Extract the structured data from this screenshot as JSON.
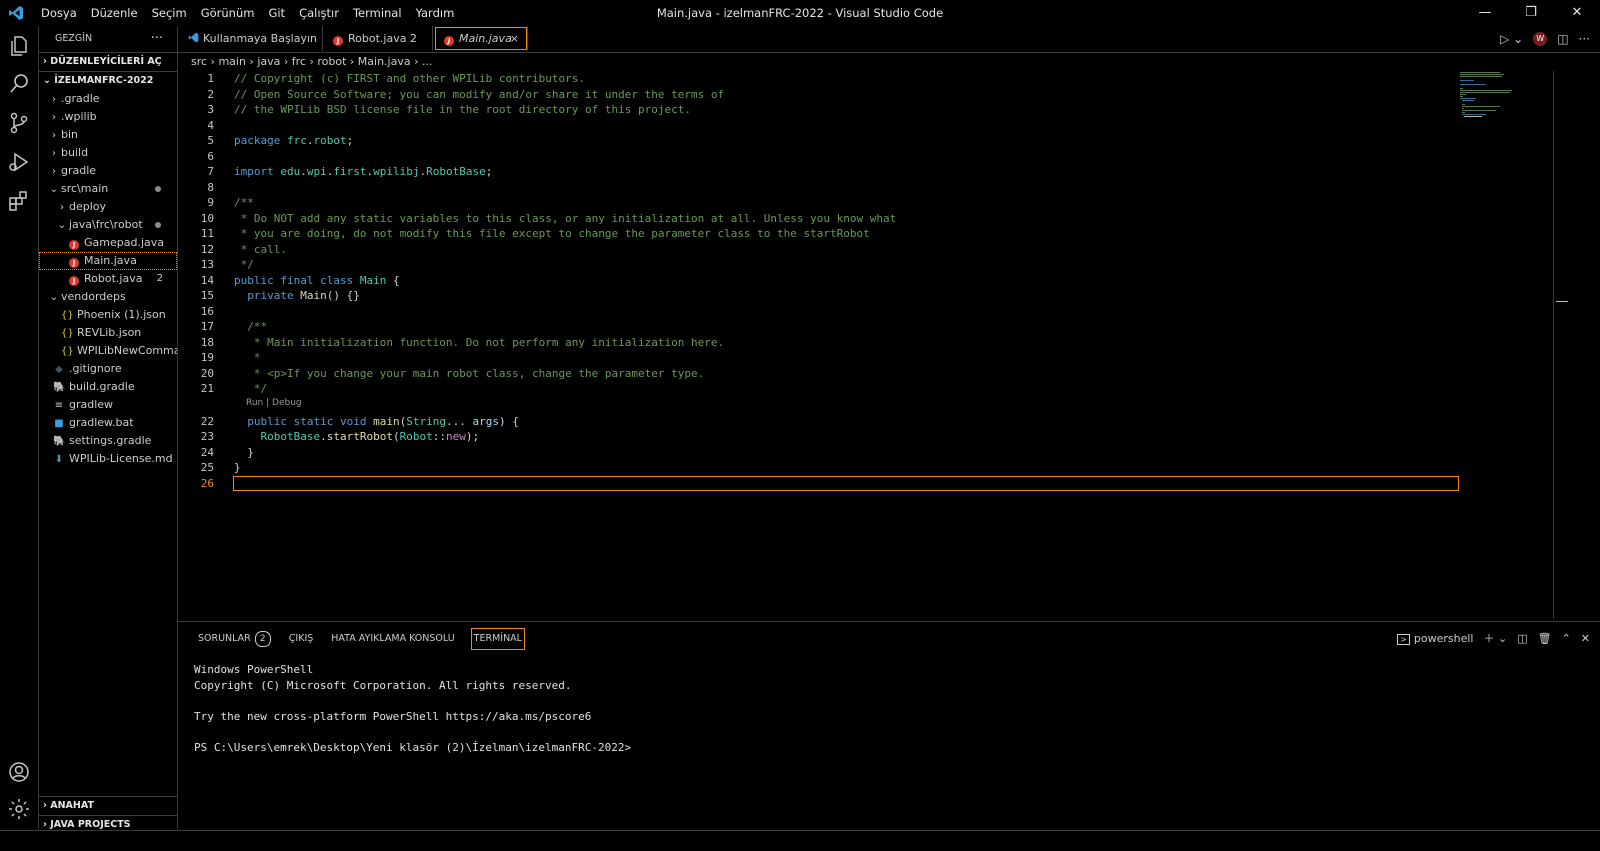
{
  "window": {
    "title": "Main.java - izelmanFRC-2022 - Visual Studio Code",
    "menu": [
      "Dosya",
      "Düzenle",
      "Seçim",
      "Görünüm",
      "Git",
      "Çalıştır",
      "Terminal",
      "Yardım"
    ],
    "controls": [
      "minimize-icon",
      "restore-icon",
      "close-icon"
    ]
  },
  "activity_bar": {
    "top": [
      "explorer-icon",
      "search-icon",
      "source-control-icon",
      "run-debug-icon",
      "extensions-icon"
    ],
    "bottom": [
      "account-icon",
      "settings-gear-icon"
    ]
  },
  "sidebar": {
    "title": "GEZGİN",
    "more": "···",
    "open_editors": "DÜZENLEYİCİLERİ AÇ",
    "project": "İZELMANFRC-2022",
    "tree": [
      {
        "label": ".gradle",
        "type": "folder",
        "chev": "›"
      },
      {
        "label": ".wpilib",
        "type": "folder",
        "chev": "›"
      },
      {
        "label": "bin",
        "type": "folder",
        "chev": "›"
      },
      {
        "label": "build",
        "type": "folder",
        "chev": "›"
      },
      {
        "label": "gradle",
        "type": "folder",
        "chev": "›"
      },
      {
        "label": "src\\main",
        "type": "folder",
        "chev": "⌄"
      },
      {
        "label": "deploy",
        "type": "folder",
        "chev": "›"
      },
      {
        "label": "java\\frc\\robot",
        "type": "folder",
        "chev": "⌄"
      },
      {
        "label": "Gamepad.java",
        "type": "java"
      },
      {
        "label": "Main.java",
        "type": "java"
      },
      {
        "label": "Robot.java",
        "type": "java",
        "badge": "2"
      },
      {
        "label": "vendordeps",
        "type": "folder",
        "chev": "⌄"
      },
      {
        "label": "Phoenix (1).json",
        "type": "json"
      },
      {
        "label": "REVLib.json",
        "type": "json"
      },
      {
        "label": "WPILibNewComma...",
        "type": "json"
      },
      {
        "label": ".gitignore",
        "type": "git"
      },
      {
        "label": "build.gradle",
        "type": "gradle"
      },
      {
        "label": "gradlew",
        "type": "text"
      },
      {
        "label": "gradlew.bat",
        "type": "bat"
      },
      {
        "label": "settings.gradle",
        "type": "gradle"
      },
      {
        "label": "WPILib-License.md",
        "type": "md"
      }
    ],
    "outline": "ANAHAT",
    "java_projects": "JAVA PROJECTS"
  },
  "tabs": [
    {
      "label": "Kullanmaya Başlayın"
    },
    {
      "label": "Robot.java 2"
    },
    {
      "label": "Main.java",
      "close": "×"
    }
  ],
  "breadcrumb": "src › main › java › frc › robot › Main.java › ...",
  "codelens": "Run | Debug",
  "panel": {
    "tabs": [
      "SORUNLAR",
      "ÇIKIŞ",
      "HATA AYIKLAMA KONSOLU",
      "TERMİNAL"
    ],
    "problems_count": "2",
    "shell": "powershell",
    "terminal_lines": [
      "Windows PowerShell",
      "Copyright (C) Microsoft Corporation. All rights reserved.",
      "",
      "Try the new cross-platform PowerShell https://aka.ms/pscore6",
      "",
      "PS C:\\Users\\emrek\\Desktop\\Yeni klasör (2)\\İzelman\\izelmanFRC-2022>"
    ]
  },
  "colors": {
    "accent": "#f38518",
    "comment": "#6a9955",
    "keyword": "#569cd6",
    "type": "#4ec9b0",
    "error": "#e5382c"
  }
}
